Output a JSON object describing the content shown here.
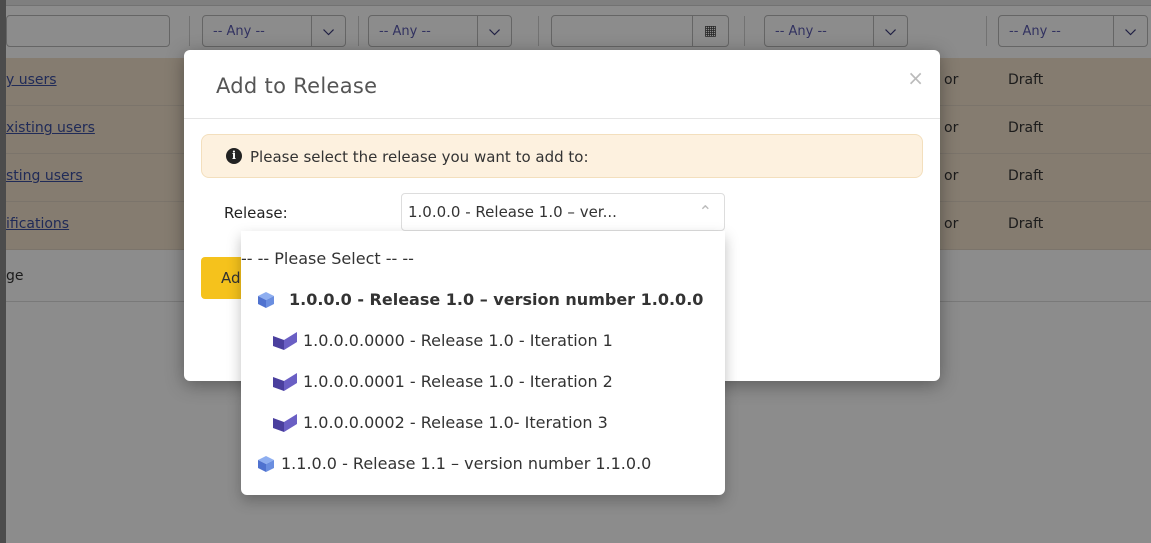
{
  "filters": {
    "any_label": "-- Any --",
    "calendar_icon": "calendar-icon"
  },
  "rows": [
    {
      "name": "y users",
      "owner": "or",
      "status": "Draft"
    },
    {
      "name": "xisting users",
      "owner": "or",
      "status": "Draft"
    },
    {
      "name": "sting users",
      "owner": "or",
      "status": "Draft"
    },
    {
      "name": "ifications",
      "owner": "or",
      "status": "Draft"
    },
    {
      "name": "ge",
      "owner": "",
      "status": ""
    }
  ],
  "modal": {
    "title": "Add to Release",
    "close_label": "×",
    "alert": "Please select the release you want to add to:",
    "release_label": "Release:",
    "selected_value": "1.0.0.0 - Release 1.0 – ver...",
    "add_button": "Ad"
  },
  "dropdown": {
    "options": [
      {
        "label": "-- -- Please Select -- --",
        "type": "placeholder"
      },
      {
        "label": "1.0.0.0 - Release 1.0 – version number 1.0.0.0",
        "type": "release",
        "selected": true
      },
      {
        "label": "1.0.0.0.0000 - Release 1.0 - Iteration 1",
        "type": "iteration"
      },
      {
        "label": "1.0.0.0.0001 - Release 1.0 - Iteration 2",
        "type": "iteration"
      },
      {
        "label": "1.0.0.0.0002 - Release 1.0- Iteration 3",
        "type": "iteration"
      },
      {
        "label": "1.1.0.0 - Release 1.1 – version number 1.1.0.0",
        "type": "release"
      }
    ]
  },
  "colors": {
    "row_highlight": "#f3e2cc",
    "link": "#3b4fa0",
    "accent_button": "#f5c21c",
    "alert_bg": "#fdf1df",
    "release_icon": "#5b7fd6",
    "iteration_icon": "#5a4fb0"
  }
}
